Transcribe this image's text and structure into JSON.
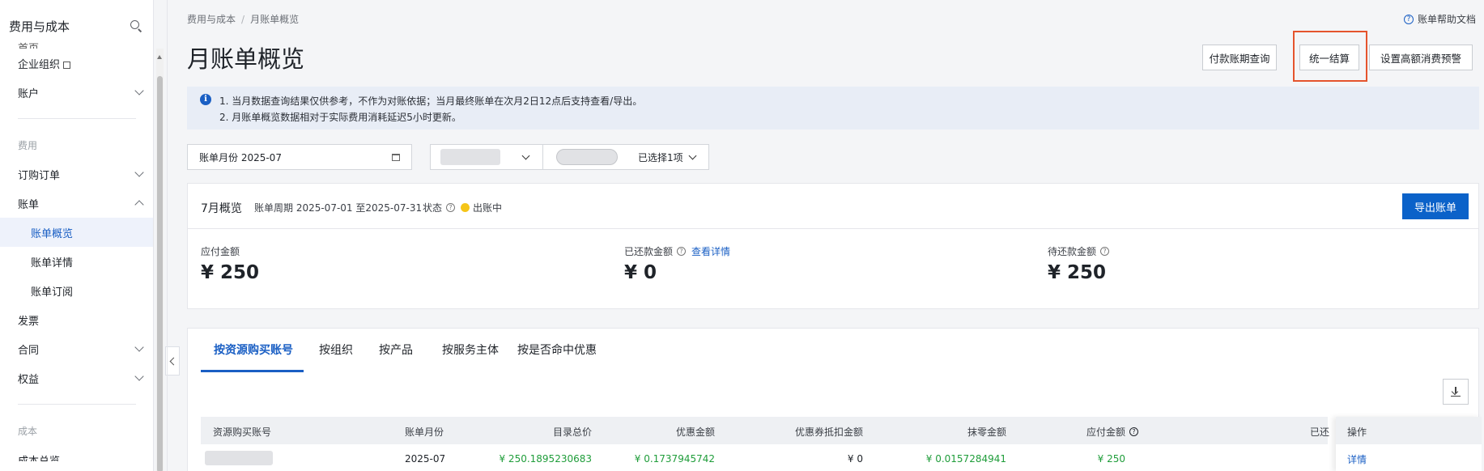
{
  "sidebar": {
    "title": "费用与成本",
    "items": [
      {
        "label": "首页",
        "kind": "cut"
      },
      {
        "label": "企业组织",
        "kind": "ext"
      },
      {
        "label": "账户",
        "kind": "expand"
      },
      {
        "label": "费用",
        "kind": "group"
      },
      {
        "label": "订购订单",
        "kind": "expand"
      },
      {
        "label": "账单",
        "kind": "collapse"
      },
      {
        "label": "账单概览",
        "kind": "sub-active"
      },
      {
        "label": "账单详情",
        "kind": "sub"
      },
      {
        "label": "账单订阅",
        "kind": "sub"
      },
      {
        "label": "发票",
        "kind": "plain"
      },
      {
        "label": "合同",
        "kind": "expand"
      },
      {
        "label": "权益",
        "kind": "expand"
      },
      {
        "label": "成本",
        "kind": "group"
      },
      {
        "label": "成本总览",
        "kind": "cut"
      }
    ]
  },
  "breadcrumb": {
    "root": "费用与成本",
    "current": "月账单概览"
  },
  "help_link": "账单帮助文档",
  "page_title": "月账单概览",
  "top_buttons": {
    "payment_query": "付款账期查询",
    "unified_settlement": "统一结算",
    "alert_settings": "设置高额消费预警"
  },
  "notice": {
    "line1": "1. 当月数据查询结果仅供参考，不作为对账依据；当月最终账单在次月2日12点后支持查看/导出。",
    "line2": "2. 月账单概览数据相对于实际费用消耗延迟5小时更新。"
  },
  "filters": {
    "billing_month": "账单月份 2025-07",
    "selected": "已选择1项"
  },
  "overview": {
    "title": "7月概览",
    "period": "账单周期 2025-07-01 至2025-07-31",
    "status_label": "状态",
    "status_value": "出账中",
    "export_button": "导出账单",
    "metrics": {
      "payable_label": "应付金额",
      "payable_value": "¥ 250",
      "repaid_label": "已还款金额",
      "repaid_link": "查看详情",
      "repaid_value": "¥ 0",
      "pending_label": "待还款金额",
      "pending_value": "¥ 250"
    }
  },
  "tabs": [
    "按资源购买账号",
    "按组织",
    "按产品",
    "按服务主体",
    "按是否命中优惠"
  ],
  "table": {
    "headers": {
      "account": "资源购买账号",
      "month": "账单月份",
      "list_price": "目录总价",
      "discount": "优惠金额",
      "coupon": "优惠券抵扣金额",
      "rounding": "抹零金额",
      "payable": "应付金额",
      "repaid": "已还",
      "ops": "操作"
    },
    "rows": [
      {
        "month": "2025-07",
        "list_price": "¥ 250.1895230683",
        "discount": "¥ 0.1737945742",
        "coupon": "¥ 0",
        "rounding": "¥ 0.0157284941",
        "payable": "¥ 250",
        "op": "详情"
      }
    ]
  }
}
